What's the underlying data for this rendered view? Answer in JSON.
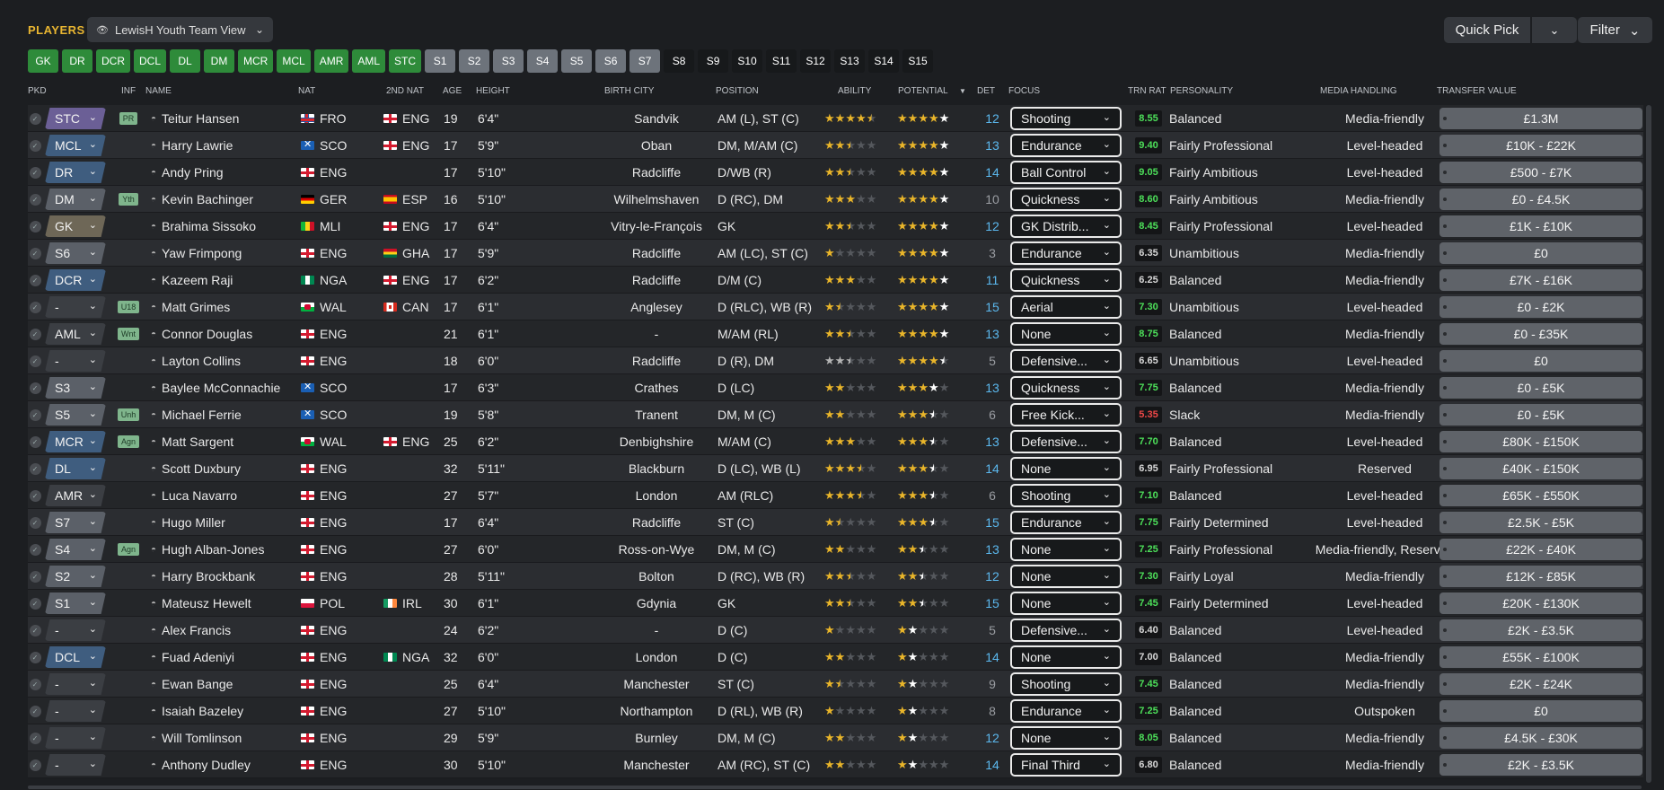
{
  "header": {
    "title": "PLAYERS",
    "view_label": "LewisH Youth Team View",
    "quick_pick": "Quick Pick",
    "filter": "Filter"
  },
  "position_filters": [
    {
      "label": "GK",
      "style": "green"
    },
    {
      "label": "DR",
      "style": "green"
    },
    {
      "label": "DCR",
      "style": "green"
    },
    {
      "label": "DCL",
      "style": "green"
    },
    {
      "label": "DL",
      "style": "green"
    },
    {
      "label": "DM",
      "style": "green"
    },
    {
      "label": "MCR",
      "style": "green"
    },
    {
      "label": "MCL",
      "style": "green"
    },
    {
      "label": "AMR",
      "style": "green"
    },
    {
      "label": "AML",
      "style": "green"
    },
    {
      "label": "STC",
      "style": "green"
    },
    {
      "label": "S1",
      "style": "grey"
    },
    {
      "label": "S2",
      "style": "grey"
    },
    {
      "label": "S3",
      "style": "grey"
    },
    {
      "label": "S4",
      "style": "grey"
    },
    {
      "label": "S5",
      "style": "grey"
    },
    {
      "label": "S6",
      "style": "grey"
    },
    {
      "label": "S7",
      "style": "grey"
    },
    {
      "label": "S8",
      "style": "dark"
    },
    {
      "label": "S9",
      "style": "dark"
    },
    {
      "label": "S10",
      "style": "dark"
    },
    {
      "label": "S11",
      "style": "dark"
    },
    {
      "label": "S12",
      "style": "dark"
    },
    {
      "label": "S13",
      "style": "dark"
    },
    {
      "label": "S14",
      "style": "dark"
    },
    {
      "label": "S15",
      "style": "dark"
    }
  ],
  "columns": {
    "pkd": "PKD",
    "inf": "INF",
    "name": "NAME",
    "nat": "NAT",
    "nat2": "2ND NAT",
    "age": "AGE",
    "height": "HEIGHT",
    "birth_city": "BIRTH CITY",
    "position": "POSITION",
    "ability": "ABILITY",
    "potential": "POTENTIAL",
    "det": "DET",
    "focus": "FOCUS",
    "trn_rat": "TRN RAT",
    "personality": "PERSONALITY",
    "media": "MEDIA HANDLING",
    "value": "TRANSFER VALUE"
  },
  "colors": {
    "pkd_purple": "#6b5f96",
    "pkd_blue": "#3f5d7f",
    "pkd_grey": "#5b6068",
    "pkd_brown": "#6e6757",
    "pkd_none": "#3b3e43"
  },
  "players": [
    {
      "pkd": "STC",
      "pkd_color": "#6b5f96",
      "inf": "PR",
      "name": "Teitur Hansen",
      "nat": "FRO",
      "nat2": "ENG",
      "age": "19",
      "height": "6'4\"",
      "city": "Sandvik",
      "position": "AM (L), ST (C)",
      "ability": 4.5,
      "ability_max": 5,
      "potential": 5,
      "det": "12",
      "det_color": "blue",
      "focus": "Shooting",
      "trn": "8.55",
      "trn_level": "hi",
      "personality": "Balanced",
      "media": "Media-friendly",
      "value": "£1.3M"
    },
    {
      "pkd": "MCL",
      "pkd_color": "#3f5d7f",
      "inf": "",
      "name": "Harry Lawrie",
      "nat": "SCO",
      "nat2": "ENG",
      "age": "17",
      "height": "5'9\"",
      "city": "Oban",
      "position": "DM, M/AM (C)",
      "ability": 2.5,
      "potential": 5,
      "det": "13",
      "det_color": "blue",
      "focus": "Endurance",
      "trn": "9.40",
      "trn_level": "hi",
      "personality": "Fairly Professional",
      "media": "Level-headed",
      "value": "£10K - £22K"
    },
    {
      "pkd": "DR",
      "pkd_color": "#3f5d7f",
      "inf": "",
      "name": "Andy Pring",
      "nat": "ENG",
      "nat2": "",
      "age": "17",
      "height": "5'10\"",
      "city": "Radcliffe",
      "position": "D/WB (R)",
      "ability": 2.5,
      "potential": 5,
      "det": "14",
      "det_color": "blue",
      "focus": "Ball Control",
      "trn": "9.05",
      "trn_level": "hi",
      "personality": "Fairly Ambitious",
      "media": "Level-headed",
      "value": "£500 - £7K"
    },
    {
      "pkd": "DM",
      "pkd_color": "#5b6068",
      "inf": "Yth",
      "name": "Kevin Bachinger",
      "nat": "GER",
      "nat2": "ESP",
      "age": "16",
      "height": "5'10\"",
      "city": "Wilhelmshaven",
      "position": "D (RC), DM",
      "ability": 3,
      "potential": 5,
      "det": "10",
      "det_color": "grey",
      "focus": "Quickness",
      "trn": "8.60",
      "trn_level": "hi",
      "personality": "Fairly Ambitious",
      "media": "Media-friendly",
      "value": "£0 - £4.5K"
    },
    {
      "pkd": "GK",
      "pkd_color": "#6e6757",
      "inf": "",
      "name": "Brahima Sissoko",
      "nat": "MLI",
      "nat2": "ENG",
      "age": "17",
      "height": "6'4\"",
      "city": "Vitry-le-François",
      "position": "GK",
      "ability": 2.5,
      "potential": 5,
      "det": "12",
      "det_color": "blue",
      "focus": "GK Distrib...",
      "trn": "8.45",
      "trn_level": "hi",
      "personality": "Fairly Professional",
      "media": "Level-headed",
      "value": "£1K - £10K"
    },
    {
      "pkd": "S6",
      "pkd_color": "#5b6068",
      "inf": "",
      "name": "Yaw Frimpong",
      "nat": "ENG",
      "nat2": "GHA",
      "age": "17",
      "height": "5'9\"",
      "city": "Radcliffe",
      "position": "AM (LC), ST (C)",
      "ability": 1,
      "potential": 5,
      "det": "3",
      "det_color": "grey",
      "focus": "Endurance",
      "trn": "6.35",
      "trn_level": "mid",
      "personality": "Unambitious",
      "media": "Media-friendly",
      "value": "£0"
    },
    {
      "pkd": "DCR",
      "pkd_color": "#3f5d7f",
      "inf": "",
      "name": "Kazeem Raji",
      "nat": "NGA",
      "nat2": "ENG",
      "age": "17",
      "height": "6'2\"",
      "city": "Radcliffe",
      "position": "D/M (C)",
      "ability": 3,
      "potential": 5,
      "det": "11",
      "det_color": "blue",
      "focus": "Quickness",
      "trn": "6.25",
      "trn_level": "mid",
      "personality": "Balanced",
      "media": "Media-friendly",
      "value": "£7K - £16K"
    },
    {
      "pkd": "-",
      "pkd_color": "#3b3e43",
      "inf": "U18",
      "name": "Matt Grimes",
      "nat": "WAL",
      "nat2": "CAN",
      "age": "17",
      "height": "6'1\"",
      "city": "Anglesey",
      "position": "D (RLC), WB (R)",
      "ability": 1.5,
      "potential": 5,
      "det": "15",
      "det_color": "blue",
      "focus": "Aerial",
      "trn": "7.30",
      "trn_level": "hi",
      "personality": "Unambitious",
      "media": "Level-headed",
      "value": "£0 - £2K"
    },
    {
      "pkd": "AML",
      "pkd_color": "#3b3e43",
      "inf": "Wnt",
      "name": "Connor Douglas",
      "nat": "ENG",
      "nat2": "",
      "age": "21",
      "height": "6'1\"",
      "city": "-",
      "position": "M/AM (RL)",
      "ability": 2.5,
      "potential": 5,
      "det": "13",
      "det_color": "blue",
      "focus": "None",
      "trn": "8.75",
      "trn_level": "hi",
      "personality": "Balanced",
      "media": "Media-friendly",
      "value": "£0 - £35K"
    },
    {
      "pkd": "-",
      "pkd_color": "#3b3e43",
      "inf": "",
      "name": "Layton Collins",
      "nat": "ENG",
      "nat2": "",
      "age": "18",
      "height": "6'0\"",
      "city": "Radcliffe",
      "position": "D (R), DM",
      "ability": 2.5,
      "ability_style": "silver",
      "potential": 4.5,
      "det": "5",
      "det_color": "grey",
      "focus": "Defensive...",
      "trn": "6.65",
      "trn_level": "mid",
      "personality": "Unambitious",
      "media": "Level-headed",
      "value": "£0"
    },
    {
      "pkd": "S3",
      "pkd_color": "#5b6068",
      "inf": "",
      "name": "Baylee McConnachie",
      "nat": "SCO",
      "nat2": "",
      "age": "17",
      "height": "6'3\"",
      "city": "Crathes",
      "position": "D (LC)",
      "ability": 2,
      "potential": 4,
      "det": "13",
      "det_color": "blue",
      "focus": "Quickness",
      "trn": "7.75",
      "trn_level": "hi",
      "personality": "Balanced",
      "media": "Media-friendly",
      "value": "£0 - £5K"
    },
    {
      "pkd": "S5",
      "pkd_color": "#5b6068",
      "inf": "Unh",
      "name": "Michael Ferrie",
      "nat": "SCO",
      "nat2": "",
      "age": "19",
      "height": "5'8\"",
      "city": "Tranent",
      "position": "DM, M (C)",
      "ability": 2,
      "potential": 3.5,
      "det": "6",
      "det_color": "grey",
      "focus": "Free Kick...",
      "trn": "5.35",
      "trn_level": "lo",
      "personality": "Slack",
      "media": "Media-friendly",
      "value": "£0 - £5K"
    },
    {
      "pkd": "MCR",
      "pkd_color": "#3f5d7f",
      "inf": "Agn",
      "name": "Matt Sargent",
      "nat": "WAL",
      "nat2": "ENG",
      "age": "25",
      "height": "6'2\"",
      "city": "Denbighshire",
      "position": "M/AM (C)",
      "ability": 3,
      "potential": 3.5,
      "det": "13",
      "det_color": "blue",
      "focus": "Defensive...",
      "trn": "7.70",
      "trn_level": "hi",
      "personality": "Balanced",
      "media": "Level-headed",
      "value": "£80K - £150K"
    },
    {
      "pkd": "DL",
      "pkd_color": "#3f5d7f",
      "inf": "",
      "name": "Scott Duxbury",
      "nat": "ENG",
      "nat2": "",
      "age": "32",
      "height": "5'11\"",
      "city": "Blackburn",
      "position": "D (LC), WB (L)",
      "ability": 3.5,
      "potential": 3.5,
      "det": "14",
      "det_color": "blue",
      "focus": "None",
      "trn": "6.95",
      "trn_level": "mid",
      "personality": "Fairly Professional",
      "media": "Reserved",
      "value": "£40K - £150K"
    },
    {
      "pkd": "AMR",
      "pkd_color": "#3b3e43",
      "inf": "",
      "name": "Luca Navarro",
      "nat": "ENG",
      "nat2": "",
      "age": "27",
      "height": "5'7\"",
      "city": "London",
      "position": "AM (RLC)",
      "ability": 3.5,
      "potential": 3.5,
      "det": "6",
      "det_color": "grey",
      "focus": "Shooting",
      "trn": "7.10",
      "trn_level": "hi",
      "personality": "Balanced",
      "media": "Level-headed",
      "value": "£65K - £550K"
    },
    {
      "pkd": "S7",
      "pkd_color": "#5b6068",
      "inf": "",
      "name": "Hugo Miller",
      "nat": "ENG",
      "nat2": "",
      "age": "17",
      "height": "6'4\"",
      "city": "Radcliffe",
      "position": "ST (C)",
      "ability": 1.5,
      "potential": 3.5,
      "det": "15",
      "det_color": "blue",
      "focus": "Endurance",
      "trn": "7.75",
      "trn_level": "hi",
      "personality": "Fairly Determined",
      "media": "Level-headed",
      "value": "£2.5K - £5K"
    },
    {
      "pkd": "S4",
      "pkd_color": "#5b6068",
      "inf": "Agn",
      "name": "Hugh Alban-Jones",
      "nat": "ENG",
      "nat2": "",
      "age": "27",
      "height": "6'0\"",
      "city": "Ross-on-Wye",
      "position": "DM, M (C)",
      "ability": 2,
      "potential": 2.5,
      "det": "13",
      "det_color": "blue",
      "focus": "None",
      "trn": "7.25",
      "trn_level": "hi",
      "personality": "Fairly Professional",
      "media": "Media-friendly, Reserved",
      "value": "£22K - £40K"
    },
    {
      "pkd": "S2",
      "pkd_color": "#5b6068",
      "inf": "",
      "name": "Harry Brockbank",
      "nat": "ENG",
      "nat2": "",
      "age": "28",
      "height": "5'11\"",
      "city": "Bolton",
      "position": "D (RC), WB (R)",
      "ability": 2.5,
      "potential": 2.5,
      "det": "12",
      "det_color": "blue",
      "focus": "None",
      "trn": "7.30",
      "trn_level": "hi",
      "personality": "Fairly Loyal",
      "media": "Media-friendly",
      "value": "£12K - £85K"
    },
    {
      "pkd": "S1",
      "pkd_color": "#5b6068",
      "inf": "",
      "name": "Mateusz Hewelt",
      "nat": "POL",
      "nat2": "IRL",
      "age": "30",
      "height": "6'1\"",
      "city": "Gdynia",
      "position": "GK",
      "ability": 2.5,
      "potential": 2.5,
      "det": "15",
      "det_color": "blue",
      "focus": "None",
      "trn": "7.45",
      "trn_level": "hi",
      "personality": "Fairly Determined",
      "media": "Level-headed",
      "value": "£20K - £130K"
    },
    {
      "pkd": "-",
      "pkd_color": "#3b3e43",
      "inf": "",
      "name": "Alex Francis",
      "nat": "ENG",
      "nat2": "",
      "age": "24",
      "height": "6'2\"",
      "city": "-",
      "position": "D (C)",
      "ability": 1,
      "potential": 2,
      "det": "5",
      "det_color": "grey",
      "focus": "Defensive...",
      "trn": "6.40",
      "trn_level": "mid",
      "personality": "Balanced",
      "media": "Level-headed",
      "value": "£2K - £3.5K"
    },
    {
      "pkd": "DCL",
      "pkd_color": "#3f5d7f",
      "inf": "",
      "name": "Fuad Adeniyi",
      "nat": "ENG",
      "nat2": "NGA",
      "age": "32",
      "height": "6'0\"",
      "city": "London",
      "position": "D (C)",
      "ability": 2,
      "potential": 2,
      "det": "14",
      "det_color": "blue",
      "focus": "None",
      "trn": "7.00",
      "trn_level": "mid",
      "personality": "Balanced",
      "media": "Media-friendly",
      "value": "£55K - £100K"
    },
    {
      "pkd": "-",
      "pkd_color": "#3b3e43",
      "inf": "",
      "name": "Ewan Bange",
      "nat": "ENG",
      "nat2": "",
      "age": "25",
      "height": "6'4\"",
      "city": "Manchester",
      "position": "ST (C)",
      "ability": 1.5,
      "potential": 2,
      "det": "9",
      "det_color": "grey",
      "focus": "Shooting",
      "trn": "7.45",
      "trn_level": "hi",
      "personality": "Balanced",
      "media": "Media-friendly",
      "value": "£2K - £24K"
    },
    {
      "pkd": "-",
      "pkd_color": "#3b3e43",
      "inf": "",
      "name": "Isaiah Bazeley",
      "nat": "ENG",
      "nat2": "",
      "age": "27",
      "height": "5'10\"",
      "city": "Northampton",
      "position": "D (RL), WB (R)",
      "ability": 1,
      "potential": 2,
      "det": "8",
      "det_color": "grey",
      "focus": "Endurance",
      "trn": "7.25",
      "trn_level": "hi",
      "personality": "Balanced",
      "media": "Outspoken",
      "value": "£0"
    },
    {
      "pkd": "-",
      "pkd_color": "#3b3e43",
      "inf": "",
      "name": "Will Tomlinson",
      "nat": "ENG",
      "nat2": "",
      "age": "29",
      "height": "5'9\"",
      "city": "Burnley",
      "position": "DM, M (C)",
      "ability": 2,
      "potential": 2,
      "det": "12",
      "det_color": "blue",
      "focus": "None",
      "trn": "8.05",
      "trn_level": "hi",
      "personality": "Balanced",
      "media": "Media-friendly",
      "value": "£4.5K - £30K"
    },
    {
      "pkd": "-",
      "pkd_color": "#3b3e43",
      "inf": "",
      "name": "Anthony Dudley",
      "nat": "ENG",
      "nat2": "",
      "age": "30",
      "height": "5'10\"",
      "city": "Manchester",
      "position": "AM (RC), ST (C)",
      "ability": 2,
      "potential": 2,
      "det": "14",
      "det_color": "blue",
      "focus": "Final Third",
      "trn": "6.80",
      "trn_level": "mid",
      "personality": "Balanced",
      "media": "Media-friendly",
      "value": "£2K - £3.5K"
    }
  ]
}
